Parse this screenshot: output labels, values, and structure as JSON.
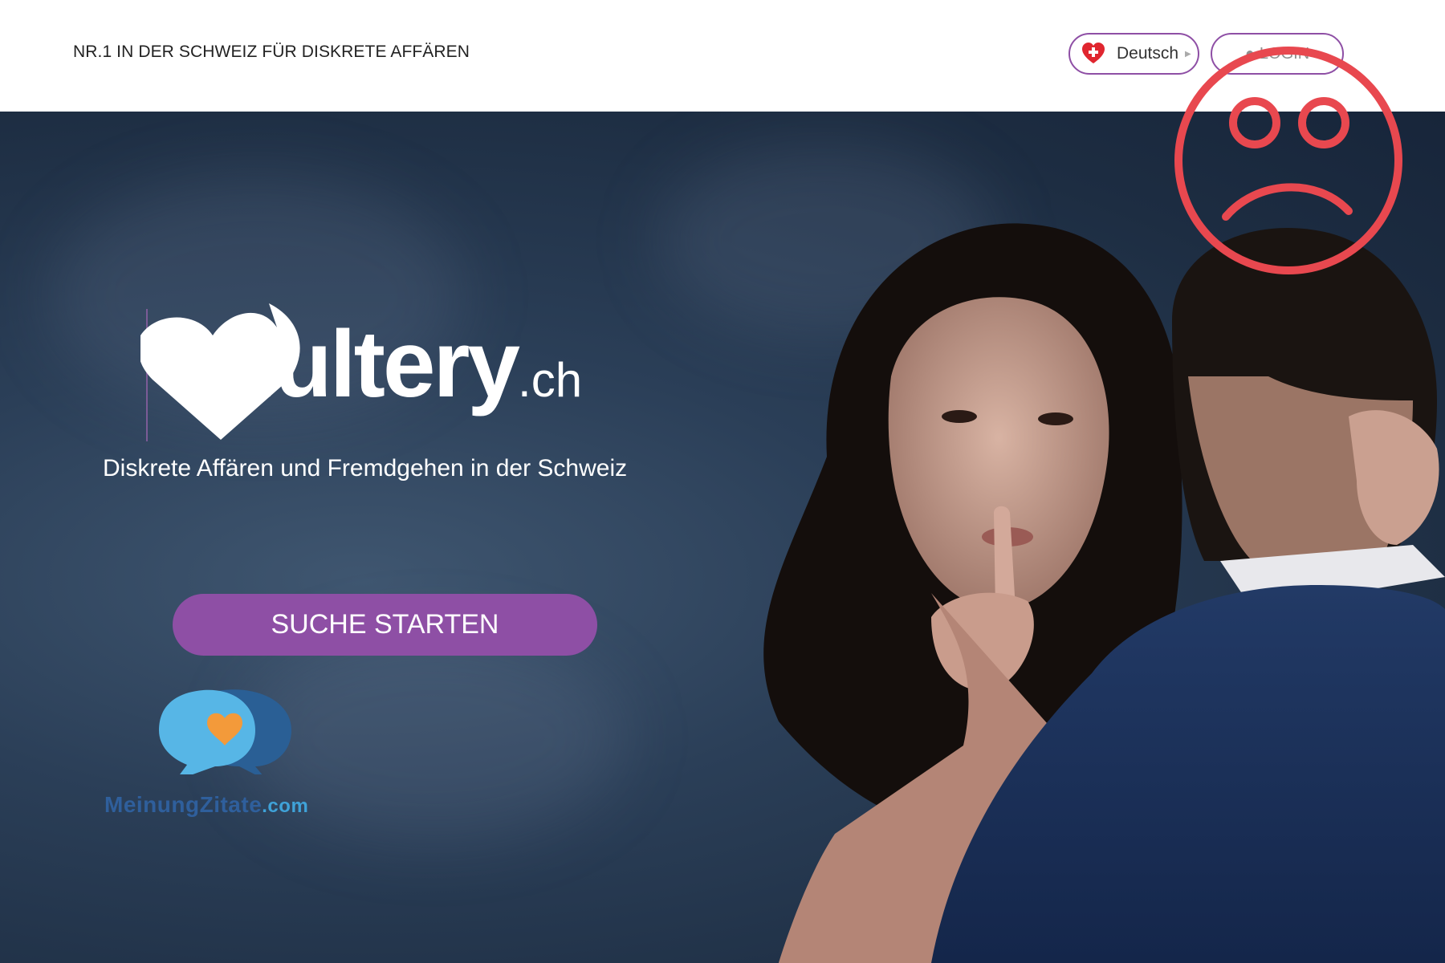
{
  "header": {
    "tagline": "NR.1 IN DER SCHWEIZ FÜR DISKRETE AFFÄREN",
    "language": {
      "label": "Deutsch",
      "flag_icon": "swiss-heart-flag-icon"
    },
    "login": {
      "label": "LOGIN",
      "icon": "user-icon"
    }
  },
  "hero": {
    "logo": {
      "name": "adultery",
      "tld": ".ch"
    },
    "subtitle": "Diskrete Affären und Fremdgehen in der Schweiz",
    "cta_label": "SUCHE STARTEN"
  },
  "watermark": {
    "name": "MeinungZitate",
    "tld": ".com"
  },
  "overlay": {
    "icon": "sad-face-icon",
    "color": "#e8484f"
  },
  "colors": {
    "accent": "#8e4fa5",
    "hero_bg": "#2b3f58",
    "white": "#ffffff"
  }
}
